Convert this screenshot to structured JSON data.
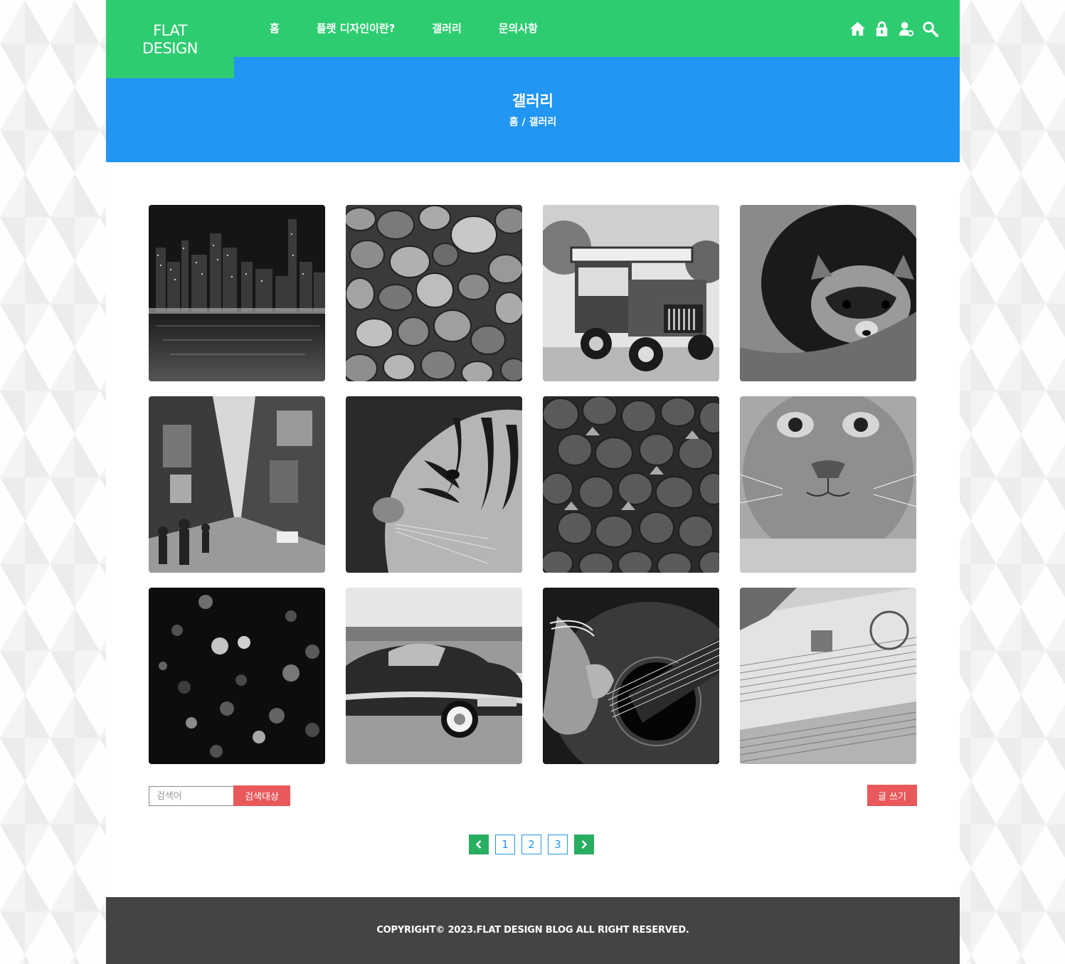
{
  "logo": {
    "line1": "FLAT",
    "line2": "DESIGN"
  },
  "nav": [
    {
      "label": "홈"
    },
    {
      "label": "플랫 디자인이란?"
    },
    {
      "label": "갤러리"
    },
    {
      "label": "문의사항"
    }
  ],
  "header_icons": [
    "home-icon",
    "lock-icon",
    "user-settings-icon",
    "search-icon"
  ],
  "banner": {
    "title": "갤러리",
    "breadcrumb_home": "홈",
    "breadcrumb_sep": " / ",
    "breadcrumb_current": "갤러리"
  },
  "gallery": [
    "city-skyline-night-photo",
    "pebbles-photo",
    "jeep-cafe-truck-photo",
    "raccoon-photo",
    "times-square-street-photo",
    "tiger-face-photo",
    "strawberries-photo",
    "cat-face-photo",
    "bokeh-lights-photo",
    "vintage-car-photo",
    "guitar-strumming-photo",
    "banknote-photo"
  ],
  "search": {
    "placeholder": "검색어",
    "button_label": "검색대상"
  },
  "write_button": "글 쓰기",
  "pagination": {
    "pages": [
      "1",
      "2",
      "3"
    ]
  },
  "footer": {
    "copyright": "COPYRIGHT© 2023.FLAT DESIGN BLOG ALL RIGHT RESERVED."
  },
  "colors": {
    "header_green": "#2ecc71",
    "banner_blue": "#2196f3",
    "button_red": "#e9595b",
    "pager_green": "#27ae60",
    "footer_gray": "#444444"
  }
}
